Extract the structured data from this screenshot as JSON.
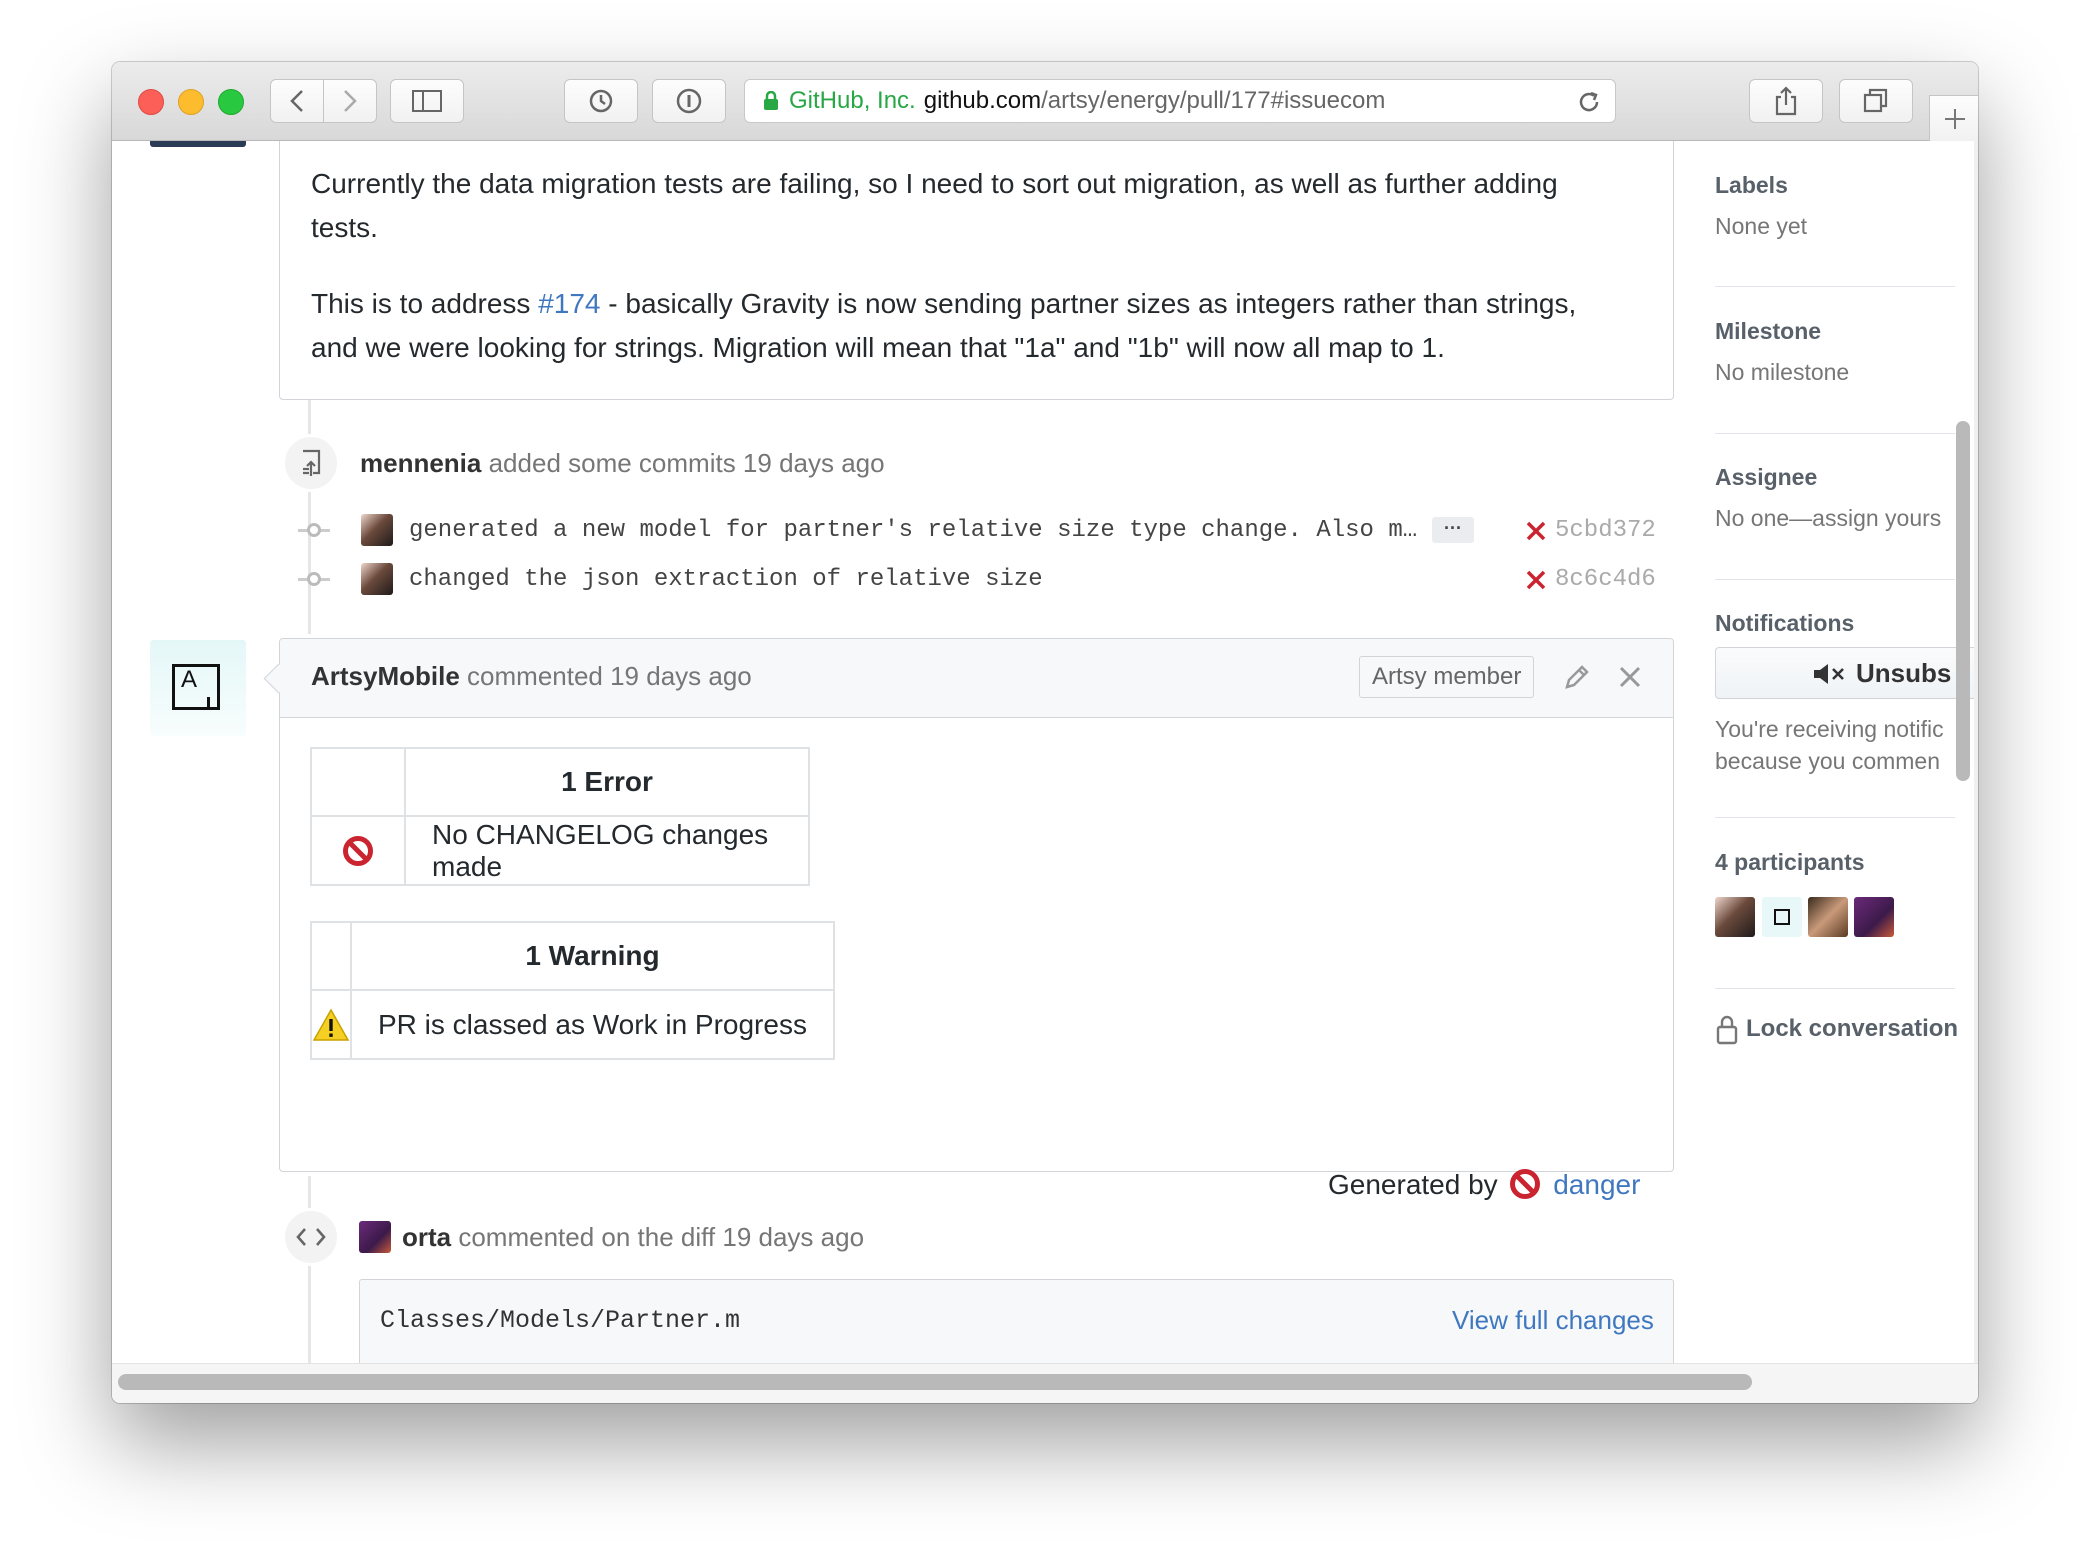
{
  "browser": {
    "url_company": "GitHub, Inc.",
    "url_domain": "github.com",
    "url_path": "/artsy/energy/pull/177#issuecom"
  },
  "description": {
    "p1": "Currently the data migration tests are failing, so I need to sort out migration, as well as further adding",
    "p1_cont": "tests.",
    "p2_pre": "This is to address ",
    "p2_link": "#174",
    "p2_post": " - basically Gravity is now sending partner sizes as integers rather than strings,",
    "p2_cont": "and we were looking for strings. Migration will mean that \"1a\" and \"1b\" will now all map to 1."
  },
  "commits_event": {
    "user": "mennenia",
    "action": " added some commits 19 days ago",
    "commits": [
      {
        "message": "generated a new model for partner's relative size type change. Also m…",
        "ellipsis": "···",
        "sha": "5cbd372"
      },
      {
        "message": "changed the json extraction of relative size",
        "sha": "8c6c4d6"
      }
    ]
  },
  "comment": {
    "author": "ArtsyMobile",
    "meta": " commented 19 days ago",
    "member_badge": "Artsy member",
    "error_table": {
      "header": "1 Error",
      "message": "No CHANGELOG changes made"
    },
    "warning_table": {
      "header": "1 Warning",
      "message": "PR is classed as Work in Progress"
    },
    "generated_by": "Generated by",
    "danger_link": "danger"
  },
  "diff_event": {
    "user": "orta",
    "action": " commented on the diff 19 days ago",
    "file": "Classes/Models/Partner.m",
    "view_full": "View full changes"
  },
  "sidebar": {
    "labels_head": "Labels",
    "labels_val": "None yet",
    "milestone_head": "Milestone",
    "milestone_val": "No milestone",
    "assignee_head": "Assignee",
    "assignee_val": "No one—assign yours",
    "notifications_head": "Notifications",
    "unsubscribe_label": "Unsubs",
    "notif_text1": "You're receiving notific",
    "notif_text2": "because you commen",
    "participants_head": "4 participants",
    "lock_label": "Lock conversation"
  },
  "colors": {
    "link": "#4078c0",
    "error_red": "#cb2431",
    "url_green": "#28a745"
  }
}
